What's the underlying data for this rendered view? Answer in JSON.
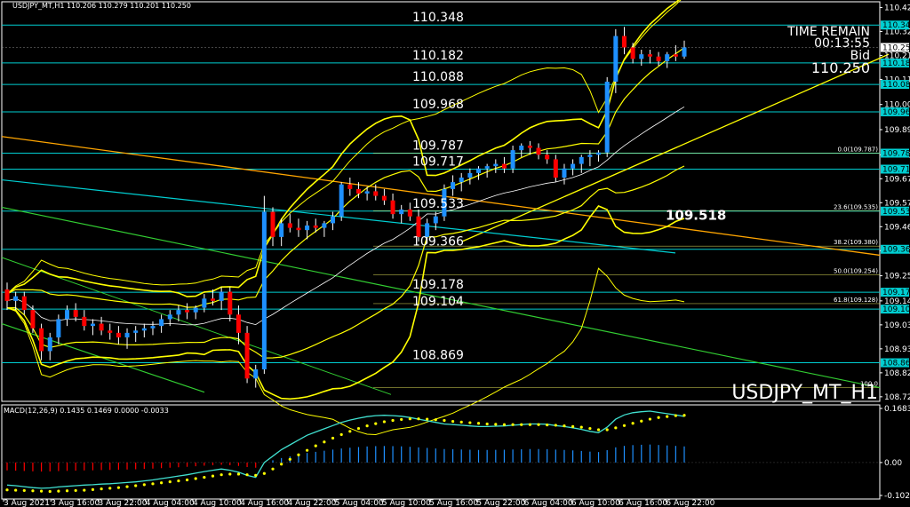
{
  "header": {
    "symbol_line": "USDJPY_MT,H1  110.206 110.279 110.201 110.250"
  },
  "info_panel": {
    "time_remain_label": "TIME REMAIN",
    "time_remain": "00:13:55",
    "bid_label": "Bid",
    "bid": "110.250"
  },
  "watermark": "USDJPY_MT_H1",
  "colors": {
    "background": "#000000",
    "bull": "#1e90ff",
    "bear": "#ff0000",
    "level": "#00ced1",
    "bands": "#ffff00",
    "trend_green": "#32cd32",
    "trend_orange": "#ffa500",
    "macd_signal": "#ffff00",
    "macd_line": "#40e0d0"
  },
  "chart_data": {
    "type": "candlestick",
    "symbol": "USDJPY_MT",
    "timeframe": "H1",
    "ylim": [
      108.7,
      110.45
    ],
    "price_ticks": [
      "110.425",
      "110.320",
      "110.215",
      "110.110",
      "110.000",
      "109.890",
      "109.780",
      "109.675",
      "109.570",
      "109.465",
      "109.360",
      "109.250",
      "109.140",
      "109.035",
      "108.930",
      "108.825",
      "108.720"
    ],
    "x_labels": [
      "3 Aug 2021",
      "3 Aug 16:00",
      "3 Aug 22:00",
      "4 Aug 04:00",
      "4 Aug 10:00",
      "4 Aug 16:00",
      "4 Aug 22:00",
      "5 Aug 04:00",
      "5 Aug 10:00",
      "5 Aug 16:00",
      "5 Aug 22:00",
      "6 Aug 04:00",
      "6 Aug 10:00",
      "6 Aug 16:00",
      "6 Aug 22:00"
    ],
    "levels": [
      {
        "value": 110.348,
        "label": "110.348",
        "tag": "110.348"
      },
      {
        "value": 110.182,
        "label": "110.182",
        "tag": "110.182"
      },
      {
        "value": 110.088,
        "label": "110.088",
        "tag": "110.088"
      },
      {
        "value": 109.968,
        "label": "109.968",
        "tag": "109.968"
      },
      {
        "value": 109.787,
        "label": "109.787",
        "tag": "109.787"
      },
      {
        "value": 109.717,
        "label": "109.717",
        "tag": "109.717"
      },
      {
        "value": 109.533,
        "label": "109.533",
        "tag": "109.533"
      },
      {
        "value": 109.366,
        "label": "109.366",
        "tag": "109.366"
      },
      {
        "value": 109.178,
        "label": "109.178",
        "tag": "109.178"
      },
      {
        "value": 109.104,
        "label": "109.104",
        "tag": "109.104"
      },
      {
        "value": 108.869,
        "label": "108.869",
        "tag": "108.869"
      }
    ],
    "fib_levels": [
      {
        "value": 109.787,
        "label": "0.0(109.787)"
      },
      {
        "value": 109.535,
        "label": "23.6(109.535)"
      },
      {
        "value": 109.38,
        "label": "38.2(109.380)"
      },
      {
        "value": 109.254,
        "label": "50.0(109.254)"
      },
      {
        "value": 109.128,
        "label": "61.8(109.128)"
      },
      {
        "value": 108.76,
        "label": "100.0"
      }
    ],
    "annotation": {
      "label": "109.518",
      "value": 109.518
    },
    "current_price": {
      "value": 110.25,
      "label": "110.250"
    },
    "candles": [
      [
        109.19,
        109.22,
        109.1,
        109.14
      ],
      [
        109.14,
        109.18,
        109.1,
        109.16
      ],
      [
        109.16,
        109.18,
        109.08,
        109.1
      ],
      [
        109.1,
        109.12,
        109.0,
        109.02
      ],
      [
        109.02,
        109.04,
        108.88,
        108.92
      ],
      [
        108.92,
        109.0,
        108.88,
        108.98
      ],
      [
        108.98,
        109.08,
        108.95,
        109.06
      ],
      [
        109.06,
        109.12,
        109.03,
        109.1
      ],
      [
        109.1,
        109.13,
        109.05,
        109.07
      ],
      [
        109.07,
        109.1,
        109.01,
        109.03
      ],
      [
        109.03,
        109.06,
        108.99,
        109.04
      ],
      [
        109.04,
        109.07,
        108.99,
        109.01
      ],
      [
        109.01,
        109.04,
        108.97,
        109.0
      ],
      [
        109.0,
        109.03,
        108.95,
        108.98
      ],
      [
        108.98,
        109.02,
        108.93,
        109.0
      ],
      [
        109.0,
        109.03,
        108.96,
        109.01
      ],
      [
        109.01,
        109.04,
        108.98,
        109.02
      ],
      [
        109.02,
        109.05,
        108.99,
        109.03
      ],
      [
        109.03,
        109.08,
        109.0,
        109.06
      ],
      [
        109.06,
        109.1,
        109.03,
        109.08
      ],
      [
        109.08,
        109.12,
        109.05,
        109.1
      ],
      [
        109.1,
        109.13,
        109.06,
        109.09
      ],
      [
        109.09,
        109.12,
        109.06,
        109.11
      ],
      [
        109.11,
        109.17,
        109.09,
        109.15
      ],
      [
        109.15,
        109.19,
        109.12,
        109.14
      ],
      [
        109.14,
        109.2,
        109.1,
        109.18
      ],
      [
        109.18,
        109.2,
        109.05,
        109.08
      ],
      [
        109.08,
        109.12,
        108.95,
        109.0
      ],
      [
        109.0,
        109.03,
        108.78,
        108.8
      ],
      [
        108.8,
        108.86,
        108.76,
        108.84
      ],
      [
        108.84,
        109.6,
        108.82,
        109.53
      ],
      [
        109.53,
        109.55,
        109.38,
        109.42
      ],
      [
        109.42,
        109.5,
        109.38,
        109.48
      ],
      [
        109.48,
        109.52,
        109.44,
        109.46
      ],
      [
        109.46,
        109.5,
        109.42,
        109.45
      ],
      [
        109.45,
        109.49,
        109.41,
        109.47
      ],
      [
        109.47,
        109.5,
        109.44,
        109.46
      ],
      [
        109.46,
        109.49,
        109.42,
        109.48
      ],
      [
        109.48,
        109.53,
        109.45,
        109.51
      ],
      [
        109.51,
        109.66,
        109.49,
        109.65
      ],
      [
        109.65,
        109.68,
        109.6,
        109.63
      ],
      [
        109.63,
        109.66,
        109.59,
        109.61
      ],
      [
        109.61,
        109.64,
        109.58,
        109.62
      ],
      [
        109.62,
        109.65,
        109.58,
        109.6
      ],
      [
        109.6,
        109.63,
        109.56,
        109.58
      ],
      [
        109.58,
        109.61,
        109.5,
        109.52
      ],
      [
        109.52,
        109.56,
        109.48,
        109.54
      ],
      [
        109.54,
        109.57,
        109.49,
        109.51
      ],
      [
        109.51,
        109.54,
        109.4,
        109.42
      ],
      [
        109.42,
        109.5,
        109.39,
        109.48
      ],
      [
        109.48,
        109.53,
        109.45,
        109.51
      ],
      [
        109.51,
        109.65,
        109.49,
        109.63
      ],
      [
        109.63,
        109.69,
        109.6,
        109.66
      ],
      [
        109.66,
        109.7,
        109.62,
        109.68
      ],
      [
        109.68,
        109.72,
        109.65,
        109.7
      ],
      [
        109.7,
        109.73,
        109.67,
        109.72
      ],
      [
        109.72,
        109.74,
        109.68,
        109.73
      ],
      [
        109.73,
        109.76,
        109.7,
        109.74
      ],
      [
        109.74,
        109.77,
        109.7,
        109.72
      ],
      [
        109.72,
        109.82,
        109.7,
        109.8
      ],
      [
        109.8,
        109.83,
        109.77,
        109.82
      ],
      [
        109.82,
        109.84,
        109.78,
        109.81
      ],
      [
        109.81,
        109.83,
        109.76,
        109.78
      ],
      [
        109.78,
        109.8,
        109.74,
        109.76
      ],
      [
        109.76,
        109.78,
        109.66,
        109.68
      ],
      [
        109.68,
        109.74,
        109.65,
        109.72
      ],
      [
        109.72,
        109.76,
        109.69,
        109.74
      ],
      [
        109.74,
        109.78,
        109.7,
        109.77
      ],
      [
        109.77,
        109.8,
        109.73,
        109.78
      ],
      [
        109.78,
        109.8,
        109.75,
        109.79
      ],
      [
        109.79,
        110.12,
        109.77,
        110.1
      ],
      [
        110.1,
        110.33,
        110.05,
        110.3
      ],
      [
        110.3,
        110.34,
        110.22,
        110.25
      ],
      [
        110.25,
        110.27,
        110.18,
        110.2
      ],
      [
        110.2,
        110.24,
        110.17,
        110.22
      ],
      [
        110.22,
        110.24,
        110.18,
        110.21
      ],
      [
        110.21,
        110.23,
        110.17,
        110.19
      ],
      [
        110.19,
        110.23,
        110.16,
        110.22
      ],
      [
        110.22,
        110.26,
        110.19,
        110.21
      ],
      [
        110.21,
        110.28,
        110.2,
        110.25
      ]
    ],
    "indicator": {
      "name": "MACD(12,26,9)",
      "header": "MACD(12,26,9)  0.1435  0.1469  0.0000  -0.0033",
      "ylim": [
        -0.1024,
        0.1683
      ],
      "ticks": [
        "0.1683",
        "0.00",
        "-0.1024"
      ],
      "macd": [
        -0.07,
        -0.072,
        -0.075,
        -0.078,
        -0.08,
        -0.079,
        -0.076,
        -0.074,
        -0.072,
        -0.07,
        -0.069,
        -0.067,
        -0.066,
        -0.064,
        -0.062,
        -0.06,
        -0.057,
        -0.054,
        -0.05,
        -0.046,
        -0.042,
        -0.038,
        -0.033,
        -0.028,
        -0.024,
        -0.02,
        -0.024,
        -0.03,
        -0.04,
        -0.046,
        0.0,
        0.02,
        0.04,
        0.055,
        0.07,
        0.085,
        0.095,
        0.105,
        0.115,
        0.125,
        0.132,
        0.138,
        0.143,
        0.146,
        0.147,
        0.146,
        0.144,
        0.14,
        0.135,
        0.13,
        0.125,
        0.12,
        0.118,
        0.116,
        0.114,
        0.112,
        0.112,
        0.113,
        0.114,
        0.116,
        0.118,
        0.12,
        0.12,
        0.119,
        0.115,
        0.112,
        0.108,
        0.103,
        0.097,
        0.093,
        0.11,
        0.135,
        0.148,
        0.155,
        0.158,
        0.16,
        0.156,
        0.152,
        0.148,
        0.1435
      ],
      "signal": [
        -0.085,
        -0.086,
        -0.087,
        -0.088,
        -0.089,
        -0.09,
        -0.089,
        -0.088,
        -0.087,
        -0.086,
        -0.084,
        -0.082,
        -0.08,
        -0.078,
        -0.075,
        -0.072,
        -0.069,
        -0.066,
        -0.063,
        -0.06,
        -0.057,
        -0.054,
        -0.05,
        -0.046,
        -0.042,
        -0.038,
        -0.036,
        -0.036,
        -0.038,
        -0.04,
        -0.034,
        -0.02,
        -0.005,
        0.01,
        0.024,
        0.038,
        0.052,
        0.064,
        0.076,
        0.087,
        0.097,
        0.106,
        0.114,
        0.121,
        0.127,
        0.131,
        0.134,
        0.136,
        0.136,
        0.135,
        0.133,
        0.131,
        0.128,
        0.126,
        0.124,
        0.122,
        0.12,
        0.119,
        0.118,
        0.118,
        0.118,
        0.118,
        0.118,
        0.117,
        0.116,
        0.114,
        0.112,
        0.11,
        0.106,
        0.102,
        0.102,
        0.108,
        0.115,
        0.122,
        0.129,
        0.135,
        0.14,
        0.143,
        0.146,
        0.1469
      ],
      "hist_scale": 0.35
    }
  }
}
